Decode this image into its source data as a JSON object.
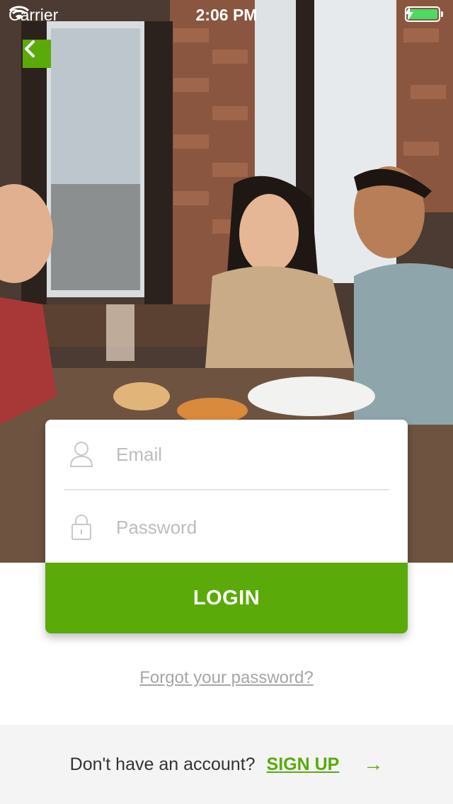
{
  "status_bar": {
    "carrier": "Carrier",
    "time": "2:06 PM",
    "wifi_icon": "wifi-icon",
    "battery_icon": "battery-icon",
    "charging_icon": "bolt-icon"
  },
  "nav": {
    "back_icon": "chevron-left-icon"
  },
  "hero": {
    "image": "friends-dining-photo"
  },
  "login_form": {
    "email_placeholder": "Email",
    "email_value": "",
    "email_icon": "user-icon",
    "password_placeholder": "Password",
    "password_value": "",
    "password_icon": "lock-icon",
    "login_label": "LOGIN"
  },
  "forgot_password": "Forgot your password?",
  "footer": {
    "prompt": "Don't have an account?",
    "signup_label": "SIGN UP",
    "arrow": "→"
  },
  "colors": {
    "accent": "#5aaa0a",
    "background": "#ffffff",
    "footer_background": "#f4f4f4"
  }
}
